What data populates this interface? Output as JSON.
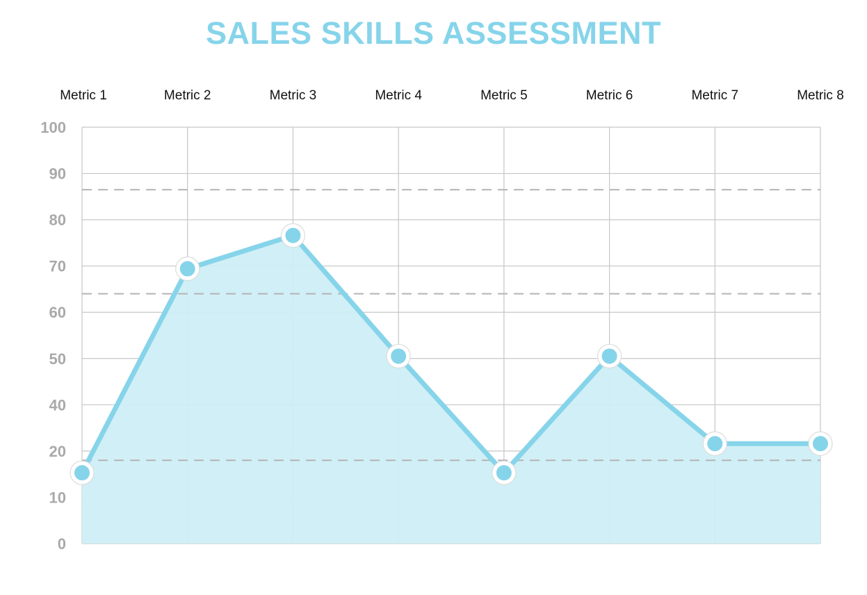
{
  "chart_data": {
    "type": "area",
    "title": "SALES SKILLS ASSESSMENT",
    "categories": [
      "Metric 1",
      "Metric 2",
      "Metric 3",
      "Metric 4",
      "Metric 5",
      "Metric 6",
      "Metric 7",
      "Metric 8"
    ],
    "y_tick_labels": [
      "0",
      "10",
      "20",
      "40",
      "50",
      "60",
      "70",
      "80",
      "90",
      "100"
    ],
    "values": [
      17,
      66,
      74,
      45,
      17,
      45,
      24,
      24
    ],
    "ylim": [
      0,
      100
    ],
    "reference_lines": [
      20,
      60,
      85
    ],
    "grid": true,
    "xlabel": "",
    "ylabel": ""
  },
  "colors": {
    "title": "#86d4ea",
    "line": "#86d4ea",
    "fill": "#cfeef6",
    "marker": "#86d4ea",
    "marker_ring": "#ffffff",
    "grid": "#c6c6c6",
    "reference_line": "#b4b4b4",
    "tick_text": "#a9a9a9",
    "category_text": "#111111"
  }
}
